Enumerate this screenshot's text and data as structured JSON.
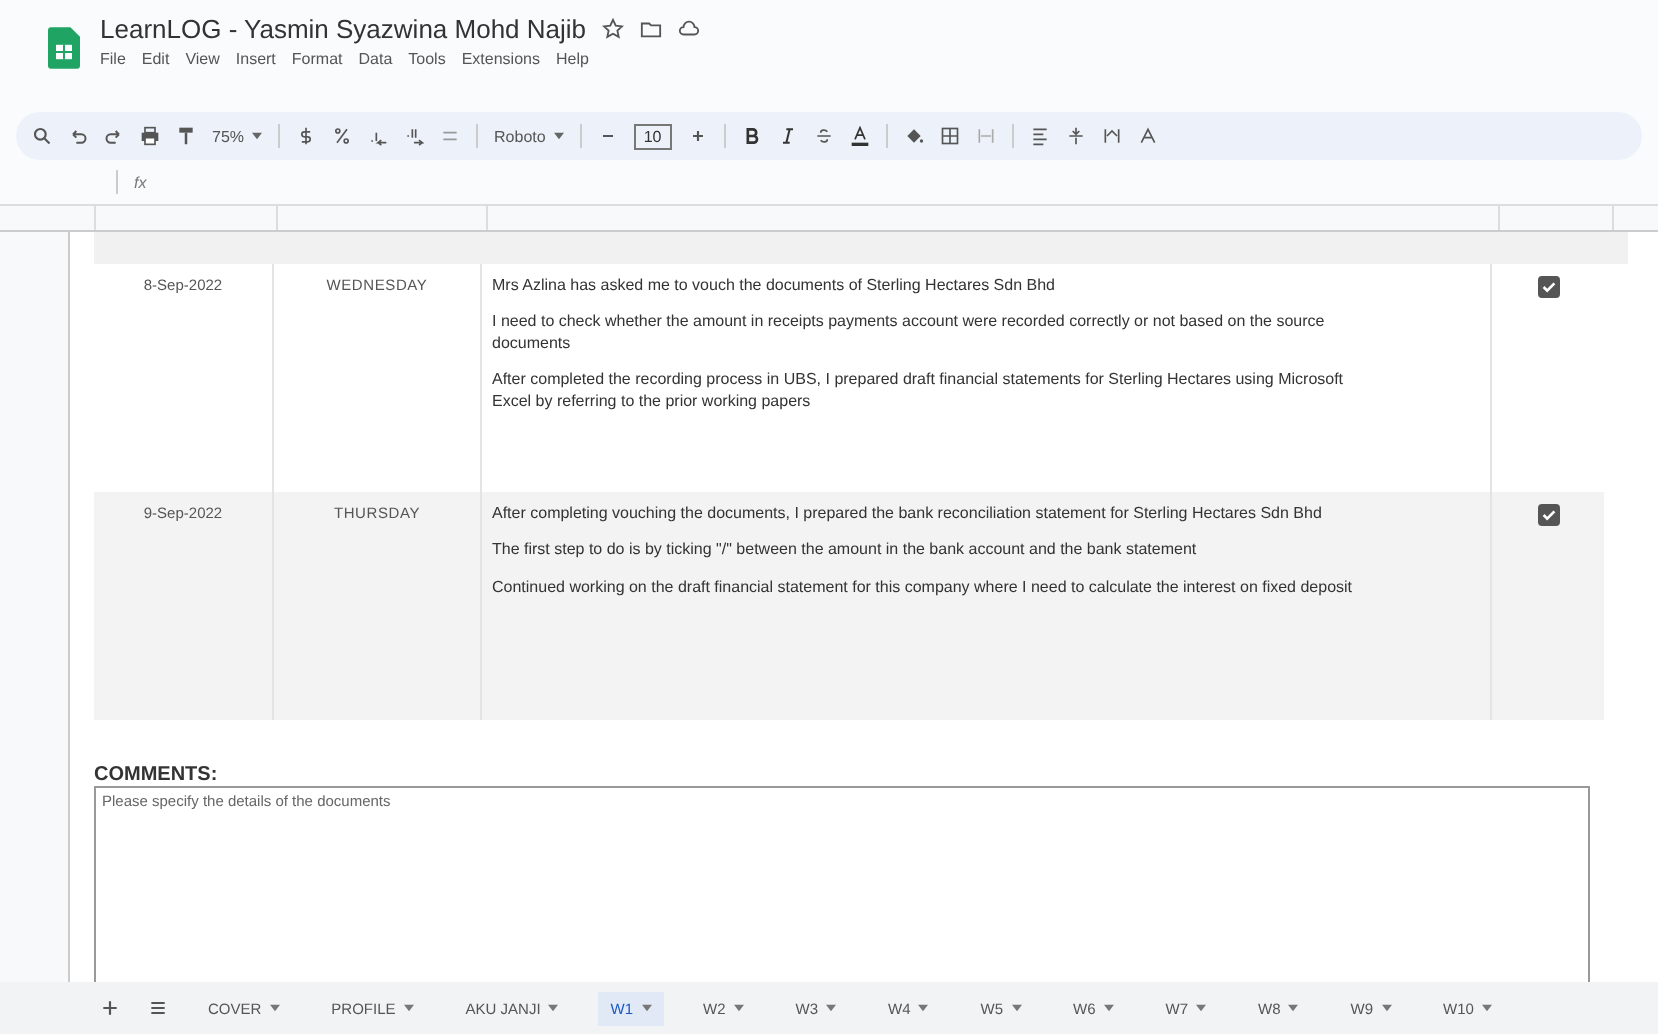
{
  "document": {
    "title": "LearnLOG - Yasmin Syazwina Mohd Najib",
    "menu": [
      "File",
      "Edit",
      "View",
      "Insert",
      "Format",
      "Data",
      "Tools",
      "Extensions",
      "Help"
    ]
  },
  "toolbar": {
    "zoom": "75%",
    "font": "Roboto",
    "font_size": "10"
  },
  "formula_bar": {
    "fx": "fx"
  },
  "entries": [
    {
      "date": "8-Sep-2022",
      "day": "WEDNESDAY",
      "shaded": false,
      "checked": true,
      "notes": [
        "Mrs Azlina has asked me to vouch the documents of Sterling Hectares Sdn Bhd",
        "I need to check whether the amount in receipts payments account were recorded correctly or not based on the source documents",
        "After completed the recording process in UBS, I prepared draft financial statements for Sterling Hectares using Microsoft Excel by referring to the prior working papers"
      ]
    },
    {
      "date": "9-Sep-2022",
      "day": "THURSDAY",
      "shaded": true,
      "checked": true,
      "notes": [
        "After completing vouching the documents, I prepared the bank reconciliation statement for Sterling Hectares Sdn Bhd",
        "The first step to do is by ticking \"/\" between the amount in the bank account and the bank statement",
        "Continued working on the draft financial statement for this company where I need to calculate the interest on fixed deposit"
      ]
    }
  ],
  "comments": {
    "label": "COMMENTS:",
    "placeholder": "Please specify the details of the documents"
  },
  "sheet_tabs": [
    {
      "label": "COVER",
      "selected": false
    },
    {
      "label": "PROFILE",
      "selected": false
    },
    {
      "label": "AKU JANJI",
      "selected": false
    },
    {
      "label": "W1",
      "selected": true
    },
    {
      "label": "W2",
      "selected": false
    },
    {
      "label": "W3",
      "selected": false
    },
    {
      "label": "W4",
      "selected": false
    },
    {
      "label": "W5",
      "selected": false
    },
    {
      "label": "W6",
      "selected": false
    },
    {
      "label": "W7",
      "selected": false
    },
    {
      "label": "W8",
      "selected": false
    },
    {
      "label": "W9",
      "selected": false
    },
    {
      "label": "W10",
      "selected": false
    }
  ]
}
